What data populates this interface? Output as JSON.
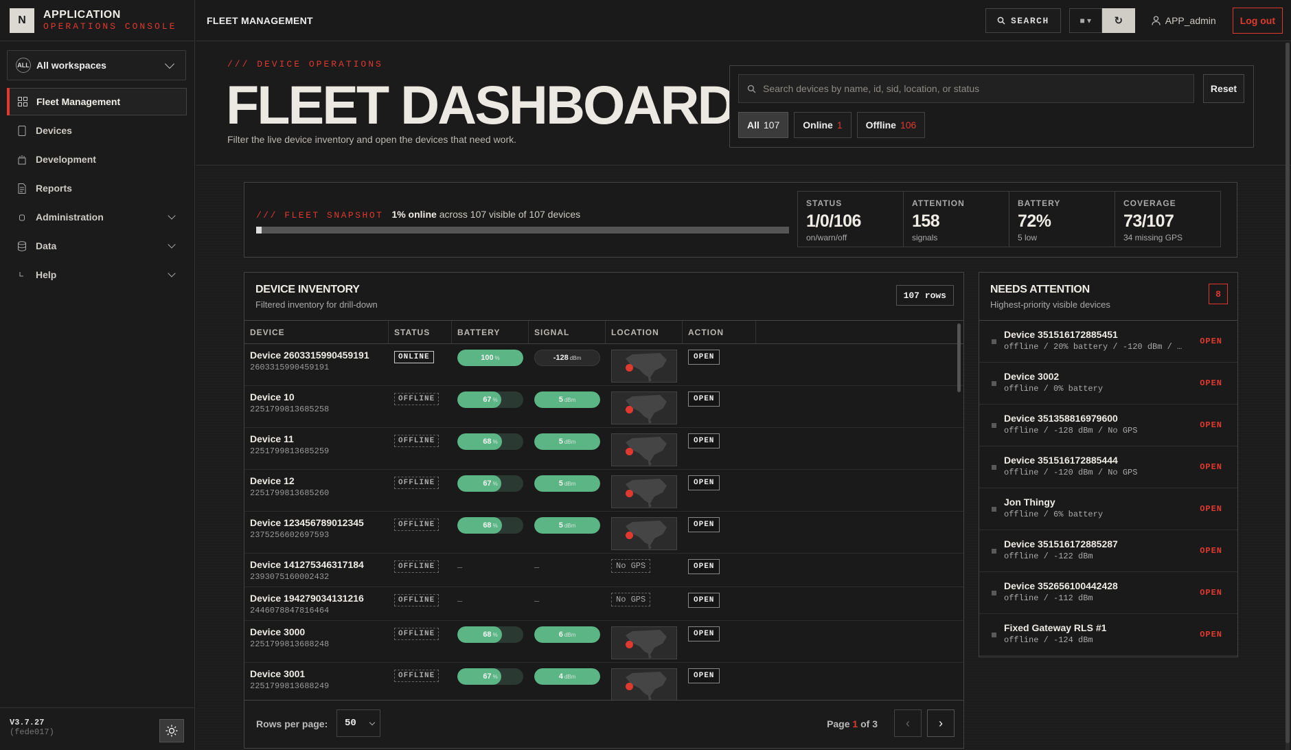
{
  "app": {
    "logo_letter": "N",
    "title": "APPLICATION",
    "subtitle": "OPERATIONS CONSOLE",
    "accent_color": "#e0392f"
  },
  "sidebar": {
    "workspace_badge": "ALL",
    "workspace_label": "All workspaces",
    "items": [
      {
        "label": "Fleet Management",
        "icon": "grid-icon",
        "active": true,
        "expandable": false
      },
      {
        "label": "Devices",
        "icon": "device-icon",
        "active": false,
        "expandable": false
      },
      {
        "label": "Development",
        "icon": "flask-icon",
        "active": false,
        "expandable": false
      },
      {
        "label": "Reports",
        "icon": "document-icon",
        "active": false,
        "expandable": false
      },
      {
        "label": "Administration",
        "icon": "admin-icon",
        "active": false,
        "expandable": true
      },
      {
        "label": "Data",
        "icon": "database-icon",
        "active": false,
        "expandable": true
      },
      {
        "label": "Help",
        "icon": "help-icon",
        "active": false,
        "expandable": true
      }
    ],
    "version": "V3.7.27",
    "commit": "(fede017)"
  },
  "topbar": {
    "title": "FLEET MANAGEMENT",
    "search_label": "SEARCH",
    "username": "APP_admin",
    "logout_label": "Log out"
  },
  "header": {
    "eyebrow": "/// DEVICE OPERATIONS",
    "title": "FLEET DASHBOARD",
    "subtitle": "Filter the live device inventory and open the devices that need work.",
    "search_placeholder": "Search devices by name, id, sid, location, or status",
    "reset_label": "Reset",
    "chips": [
      {
        "label": "All",
        "count": "107",
        "active": true
      },
      {
        "label": "Online",
        "count": "1",
        "active": false
      },
      {
        "label": "Offline",
        "count": "106",
        "active": false
      }
    ]
  },
  "snapshot": {
    "tag": "/// FLEET SNAPSHOT",
    "headline_bold": "1% online",
    "headline_rest": "across 107 visible of 107 devices",
    "progress": 0.01,
    "stats": [
      {
        "label": "STATUS",
        "value": "1/0/106",
        "sub": "on/warn/off"
      },
      {
        "label": "ATTENTION",
        "value": "158",
        "sub": "signals"
      },
      {
        "label": "BATTERY",
        "value": "72%",
        "sub": "5 low"
      },
      {
        "label": "COVERAGE",
        "value": "73/107",
        "sub": "34 missing GPS"
      }
    ]
  },
  "inventory": {
    "title": "DEVICE INVENTORY",
    "subtitle": "Filtered inventory for drill-down",
    "rows_badge": "107 rows",
    "columns": [
      "DEVICE",
      "STATUS",
      "BATTERY",
      "SIGNAL",
      "LOCATION",
      "ACTION"
    ],
    "rows": [
      {
        "name": "Device 2603315990459191",
        "id": "2603315990459191",
        "status": "ONLINE",
        "battery": "100",
        "battery_pct": 1.0,
        "signal": "-128",
        "signal_style": "dark",
        "gps": true,
        "action": "OPEN"
      },
      {
        "name": "Device 10",
        "id": "2251799813685258",
        "status": "OFFLINE",
        "battery": "67",
        "battery_pct": 0.67,
        "signal": "5",
        "signal_style": "green",
        "gps": true,
        "action": "OPEN"
      },
      {
        "name": "Device 11",
        "id": "2251799813685259",
        "status": "OFFLINE",
        "battery": "68",
        "battery_pct": 0.68,
        "signal": "5",
        "signal_style": "green",
        "gps": true,
        "action": "OPEN"
      },
      {
        "name": "Device 12",
        "id": "2251799813685260",
        "status": "OFFLINE",
        "battery": "67",
        "battery_pct": 0.67,
        "signal": "5",
        "signal_style": "green",
        "gps": true,
        "action": "OPEN"
      },
      {
        "name": "Device 123456789012345",
        "id": "2375256602697593",
        "status": "OFFLINE",
        "battery": "68",
        "battery_pct": 0.68,
        "signal": "5",
        "signal_style": "green",
        "gps": true,
        "action": "OPEN"
      },
      {
        "name": "Device 141275346317184",
        "id": "2393075160002432",
        "status": "OFFLINE",
        "battery": "–",
        "battery_pct": null,
        "signal": "–",
        "signal_style": "none",
        "gps": false,
        "action": "OPEN"
      },
      {
        "name": "Device 194279034131216",
        "id": "2446078847816464",
        "status": "OFFLINE",
        "battery": "–",
        "battery_pct": null,
        "signal": "–",
        "signal_style": "none",
        "gps": false,
        "action": "OPEN"
      },
      {
        "name": "Device 3000",
        "id": "2251799813688248",
        "status": "OFFLINE",
        "battery": "68",
        "battery_pct": 0.68,
        "signal": "6",
        "signal_style": "green",
        "gps": true,
        "action": "OPEN"
      },
      {
        "name": "Device 3001",
        "id": "2251799813688249",
        "status": "OFFLINE",
        "battery": "67",
        "battery_pct": 0.67,
        "signal": "4",
        "signal_style": "green",
        "gps": true,
        "action": "OPEN"
      }
    ],
    "battery_unit": "%",
    "signal_unit": "dBm",
    "nogps_label": "No GPS",
    "rows_per_page_label": "Rows per page:",
    "rows_per_page": "50",
    "page_prefix": "Page",
    "page_current": "1",
    "page_of": "of 3"
  },
  "attention": {
    "title": "NEEDS ATTENTION",
    "subtitle": "Highest-priority visible devices",
    "count": "8",
    "items": [
      {
        "name": "Device 351516172885451",
        "detail": "offline / 20% battery / -120 dBm / …",
        "action": "OPEN"
      },
      {
        "name": "Device 3002",
        "detail": "offline / 0% battery",
        "action": "OPEN"
      },
      {
        "name": "Device 351358816979600",
        "detail": "offline / -128 dBm / No GPS",
        "action": "OPEN"
      },
      {
        "name": "Device 351516172885444",
        "detail": "offline / -120 dBm / No GPS",
        "action": "OPEN"
      },
      {
        "name": "Jon Thingy",
        "detail": "offline / 6% battery",
        "action": "OPEN"
      },
      {
        "name": "Device 351516172885287",
        "detail": "offline / -122 dBm",
        "action": "OPEN"
      },
      {
        "name": "Device 352656100442428",
        "detail": "offline / -112 dBm",
        "action": "OPEN"
      },
      {
        "name": "Fixed Gateway RLS #1",
        "detail": "offline / -124 dBm",
        "action": "OPEN"
      }
    ]
  }
}
